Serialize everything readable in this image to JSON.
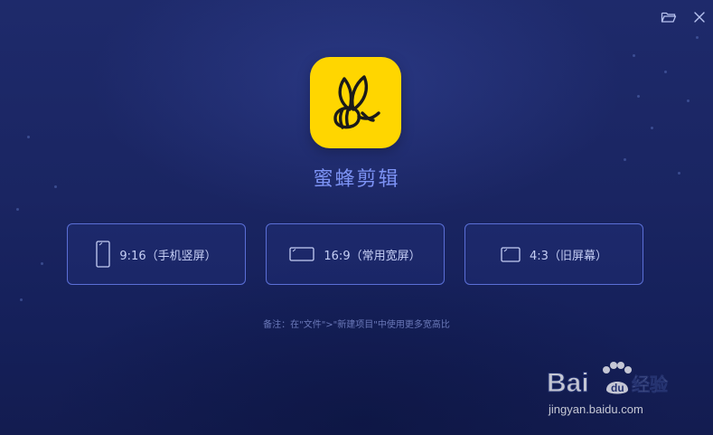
{
  "window": {
    "folder_icon": "folder-open-icon",
    "close_icon": "close-icon"
  },
  "app": {
    "name": "蜜蜂剪辑",
    "logo_icon": "bee-icon",
    "logo_color": "#ffd600"
  },
  "ratio_options": [
    {
      "label": "9:16（手机竖屏）",
      "icon": "portrait-phone-icon"
    },
    {
      "label": "16:9（常用宽屏）",
      "icon": "widescreen-icon"
    },
    {
      "label": "4:3（旧屏幕）",
      "icon": "standard-screen-icon"
    }
  ],
  "note": "备注：在\"文件\">\"新建项目\"中使用更多宽高比",
  "colors": {
    "accent": "#7d93f5",
    "button_border": "#5b6fd6",
    "background": "#1a2562"
  }
}
